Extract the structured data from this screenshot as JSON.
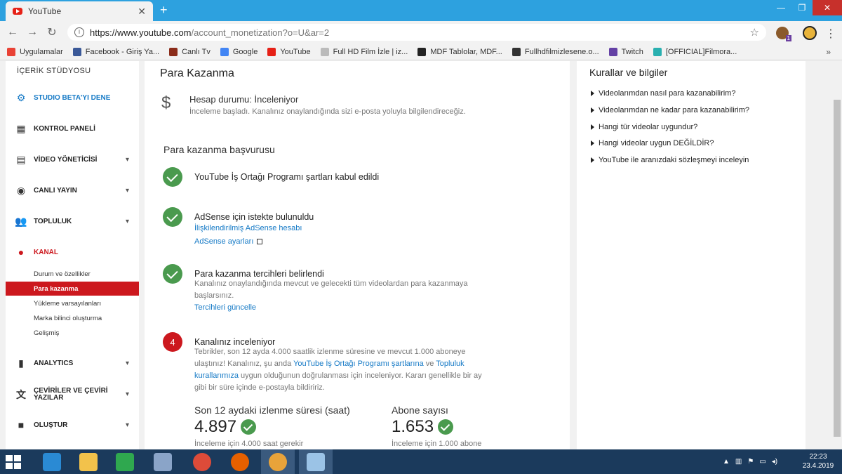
{
  "browser": {
    "tab_title": "YouTube",
    "url_host": "https://www.youtube.com",
    "url_path": "/account_monetization?o=U&ar=2",
    "ext_badge": "1"
  },
  "bookmarks": [
    {
      "label": "Uygulamalar",
      "icon": "apps-grid-icon",
      "color": "#e94235"
    },
    {
      "label": "Facebook - Giriş Ya...",
      "icon": "facebook-icon",
      "color": "#3b5998"
    },
    {
      "label": "Canlı Tv",
      "icon": "tv-icon",
      "color": "#8b2c1a"
    },
    {
      "label": "Google",
      "icon": "google-icon",
      "color": "#4285f4"
    },
    {
      "label": "YouTube",
      "icon": "youtube-icon",
      "color": "#e62117"
    },
    {
      "label": "Full HD Film İzle | iz...",
      "icon": "page-icon",
      "color": "#bbbbbb"
    },
    {
      "label": "MDF Tablolar, MDF...",
      "icon": "ee-icon",
      "color": "#222222"
    },
    {
      "label": "Fullhdfilmizlesene.o...",
      "icon": "film-reel-icon",
      "color": "#333333"
    },
    {
      "label": "Twitch",
      "icon": "twitch-icon",
      "color": "#6441a5"
    },
    {
      "label": "[OFFICIAL]Filmora...",
      "icon": "filmora-icon",
      "color": "#2ab0b0"
    }
  ],
  "sidebar": {
    "header": "İÇERİK STÜDYOSU",
    "items": [
      {
        "label": "STUDIO BETA'YI DENE",
        "icon": "gear-icon",
        "color": "#167ac6",
        "chevron": false
      },
      {
        "label": "KONTROL PANELİ",
        "icon": "dashboard-icon",
        "color": "#222222",
        "chevron": false
      },
      {
        "label": "VİDEO YÖNETİCİSİ",
        "icon": "video-manager-icon",
        "color": "#222222",
        "chevron": true
      },
      {
        "label": "CANLI YAYIN",
        "icon": "live-icon",
        "color": "#222222",
        "chevron": true
      },
      {
        "label": "TOPLULUK",
        "icon": "community-icon",
        "color": "#222222",
        "chevron": true
      },
      {
        "label": "KANAL",
        "icon": "channel-icon",
        "color": "#cc181e",
        "chevron": false
      }
    ],
    "sub_items": [
      "Durum ve özellikler",
      "Para kazanma",
      "Yükleme varsayılanları",
      "Marka bilinci oluşturma",
      "Gelişmiş"
    ],
    "active_sub": "Para kazanma",
    "items_bottom": [
      {
        "label": "ANALYTICS",
        "icon": "analytics-icon",
        "chevron": true
      },
      {
        "label": "ÇEVİRİLER VE ÇEVİRİ YAZILAR",
        "icon": "translate-icon",
        "chevron": true
      },
      {
        "label": "OLUŞTUR",
        "icon": "create-icon",
        "chevron": true
      }
    ]
  },
  "main": {
    "title": "Para Kazanma",
    "status_title": "Hesap durumu: İnceleniyor",
    "status_desc": "İnceleme başladı. Kanalınız onaylandığında sizi e-posta yoluyla bilgilendireceğiz.",
    "section_title": "Para kazanma başvurusu",
    "step1_title": "YouTube İş Ortağı Programı şartları kabul edildi",
    "step2_title": "AdSense için istekte bulunuldu",
    "step2_link1": "İlişkilendirilmiş AdSense hesabı",
    "step2_link2": "AdSense ayarları",
    "step3_title": "Para kazanma tercihleri belirlendi",
    "step3_text": "Kanalınız onaylandığında mevcut ve gelecekti tüm videolardan para kazanmaya başlarsınız.",
    "step3_link": "Tercihleri güncelle",
    "step4_num": "4",
    "step4_title": "Kanalınız inceleniyor",
    "step4_text_a": "Tebrikler, son 12 ayda 4.000 saatlik izlenme süresine ve mevcut 1.000 aboneye ulaştınız! Kanalınız, şu anda ",
    "step4_link_a": "YouTube İş Ortağı Programı şartlarına",
    "step4_text_b": " ve ",
    "step4_link_b": "Topluluk kurallarımıza",
    "step4_text_c": " uygun olduğunun doğrulanması için inceleniyor. Kararı genellikle bir ay gibi bir süre içinde e-postayla bildiririz.",
    "stat1_label": "Son 12 aydaki izlenme süresi (saat)",
    "stat1_value": "4.897",
    "stat1_note": "İnceleme için 4.000 saat gerekir",
    "stat2_label": "Abone sayısı",
    "stat2_value": "1.653",
    "stat2_note": "İnceleme için 1.000 abone"
  },
  "rules": {
    "title": "Kurallar ve bilgiler",
    "items": [
      "Videolarımdan nasıl para kazanabilirim?",
      "Videolarımdan ne kadar para kazanabilirim?",
      "Hangi tür videolar uygundur?",
      "Hangi videolar uygun DEĞİLDİR?",
      "YouTube ile aranızdaki sözleşmeyi inceleyin"
    ]
  },
  "taskbar": {
    "apps": [
      {
        "name": "internet-explorer-icon",
        "color": "#2a8ad4"
      },
      {
        "name": "file-explorer-icon",
        "color": "#f2c24b"
      },
      {
        "name": "store-icon",
        "color": "#2fa84f"
      },
      {
        "name": "control-panel-icon",
        "color": "#8aa4c8"
      },
      {
        "name": "chrome-icon",
        "color": "#dd4b39"
      },
      {
        "name": "firefox-icon",
        "color": "#e66000"
      },
      {
        "name": "chrome-canary-icon",
        "color": "#e8a33a"
      },
      {
        "name": "notepad-icon",
        "color": "#9bc3e6"
      }
    ],
    "time": "22:23",
    "date": "23.4.2019"
  }
}
